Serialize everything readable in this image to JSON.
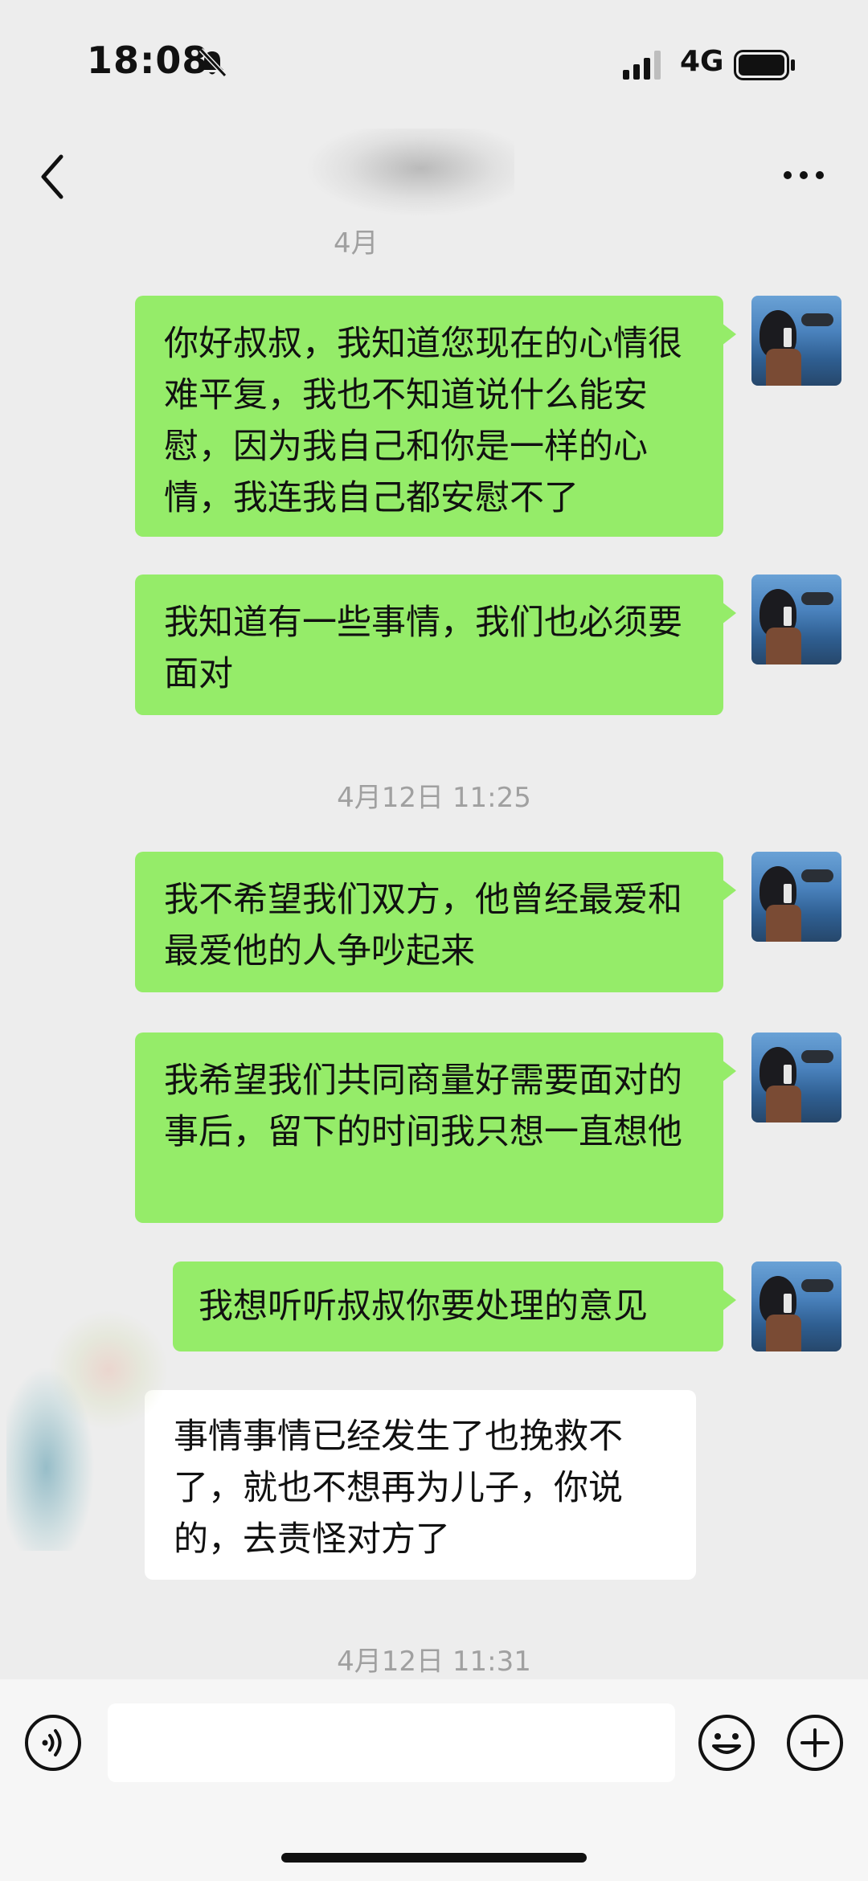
{
  "status_bar": {
    "time": "18:08",
    "network": "4G"
  },
  "nav": {
    "title_blurred": true
  },
  "timestamps": {
    "top_partial": "4月",
    "mid": "4月12日 11:25",
    "bottom": "4月12日 11:31"
  },
  "messages": [
    {
      "side": "out",
      "text": "你好叔叔，我知道您现在的心情很难平复，我也不知道说什么能安慰，因为我自己和你是一样的心情，我连我自己都安慰不了"
    },
    {
      "side": "out",
      "text": "我知道有一些事情，我们也必须要面对"
    },
    {
      "side": "out",
      "text": "我不希望我们双方，他曾经最爱和最爱他的人争吵起来"
    },
    {
      "side": "out",
      "text": "我希望我们共同商量好需要面对的事后，留下的时间我只想一直想他"
    },
    {
      "side": "out",
      "text": "我想听听叔叔你要处理的意见"
    },
    {
      "side": "in",
      "text": "事情事情已经发生了也挽救不了，就也不想再为儿子，你说的，去责怪对方了"
    }
  ],
  "input": {
    "placeholder": ""
  },
  "icons": {
    "back": "chevron-left-icon",
    "more": "more-dots-icon",
    "voice": "voice-icon",
    "emoji": "emoji-icon",
    "plus": "plus-icon"
  },
  "colors": {
    "outgoing_bubble": "#95ec69",
    "incoming_bubble": "#ffffff",
    "background": "#ededed"
  }
}
